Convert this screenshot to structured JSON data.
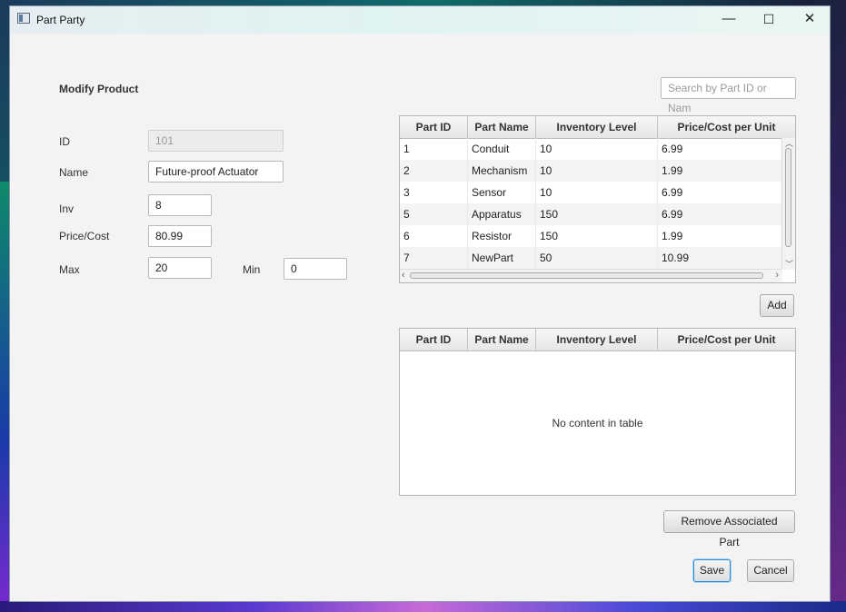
{
  "window": {
    "title": "Part Party",
    "controls": {
      "minimize": "—",
      "maximize": "☐",
      "close": "✕"
    }
  },
  "form": {
    "heading": "Modify Product",
    "id": {
      "label": "ID",
      "value": "101"
    },
    "name": {
      "label": "Name",
      "value": "Future-proof Actuator"
    },
    "inv": {
      "label": "Inv",
      "value": "8"
    },
    "price": {
      "label": "Price/Cost",
      "value": "80.99"
    },
    "max": {
      "label": "Max",
      "value": "20"
    },
    "min": {
      "label": "Min",
      "value": "0"
    }
  },
  "search": {
    "placeholder": "Search by Part ID or Nam"
  },
  "parts_table": {
    "columns": [
      "Part ID",
      "Part Name",
      "Inventory Level",
      "Price/Cost per Unit"
    ],
    "rows": [
      [
        "1",
        "Conduit",
        "10",
        "6.99"
      ],
      [
        "2",
        "Mechanism",
        "10",
        "1.99"
      ],
      [
        "3",
        "Sensor",
        "10",
        "6.99"
      ],
      [
        "5",
        "Apparatus",
        "150",
        "6.99"
      ],
      [
        "6",
        "Resistor",
        "150",
        "1.99"
      ],
      [
        "7",
        "NewPart",
        "50",
        "10.99"
      ]
    ]
  },
  "associated_table": {
    "columns": [
      "Part ID",
      "Part Name",
      "Inventory Level",
      "Price/Cost per Unit"
    ],
    "empty_message": "No content in table"
  },
  "buttons": {
    "add": "Add",
    "remove": "Remove Associated Part",
    "save": "Save",
    "cancel": "Cancel"
  }
}
